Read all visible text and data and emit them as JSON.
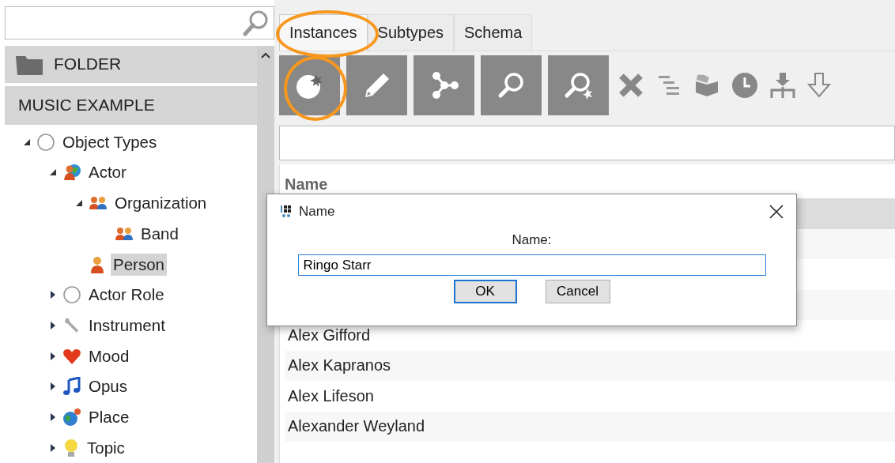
{
  "sidebar": {
    "folder_header": "FOLDER",
    "section_header": "MUSIC EXAMPLE",
    "tree": [
      {
        "label": "Object Types",
        "kind": "circle",
        "expandable": true,
        "expanded": true,
        "selected": false,
        "children": [
          {
            "label": "Actor",
            "kind": "actor",
            "expandable": true,
            "expanded": true,
            "selected": false,
            "children": [
              {
                "label": "Organization",
                "kind": "group",
                "expandable": true,
                "expanded": true,
                "selected": false,
                "children": [
                  {
                    "label": "Band",
                    "kind": "group",
                    "expandable": false,
                    "selected": false
                  }
                ]
              },
              {
                "label": "Person",
                "kind": "person",
                "expandable": false,
                "selected": true
              }
            ]
          },
          {
            "label": "Actor Role",
            "kind": "circle",
            "expandable": true,
            "expanded": false,
            "selected": false
          },
          {
            "label": "Instrument",
            "kind": "wrench",
            "expandable": true,
            "expanded": false,
            "selected": false
          },
          {
            "label": "Mood",
            "kind": "heart",
            "expandable": true,
            "expanded": false,
            "selected": false
          },
          {
            "label": "Opus",
            "kind": "note",
            "expandable": true,
            "expanded": false,
            "selected": false
          },
          {
            "label": "Place",
            "kind": "globe",
            "expandable": true,
            "expanded": false,
            "selected": false
          },
          {
            "label": "Topic",
            "kind": "bulb",
            "expandable": true,
            "expanded": false,
            "selected": false
          }
        ]
      }
    ]
  },
  "tabs": [
    {
      "label": "Instances",
      "selected": true
    },
    {
      "label": "Subtypes",
      "selected": false
    },
    {
      "label": "Schema",
      "selected": false
    }
  ],
  "toolbar": [
    {
      "kind": "new",
      "boxed": true
    },
    {
      "kind": "edit",
      "boxed": true
    },
    {
      "kind": "graph",
      "boxed": true
    },
    {
      "kind": "search",
      "boxed": true
    },
    {
      "kind": "search-new",
      "boxed": true
    },
    {
      "kind": "delete",
      "boxed": false
    },
    {
      "kind": "list",
      "boxed": false
    },
    {
      "kind": "box",
      "boxed": false
    },
    {
      "kind": "clock",
      "boxed": false
    },
    {
      "kind": "merge",
      "boxed": false
    },
    {
      "kind": "down",
      "boxed": false
    }
  ],
  "table": {
    "columns": [
      "Name"
    ],
    "rows": [
      "Alex Gifford",
      "Alex Kapranos",
      "Alex Lifeson",
      "Alexander Weyland"
    ]
  },
  "dialog": {
    "title": "Name",
    "label": "Name:",
    "value": "Ringo Starr",
    "buttons": [
      {
        "label": "OK",
        "default": true
      },
      {
        "label": "Cancel",
        "default": false
      }
    ]
  }
}
